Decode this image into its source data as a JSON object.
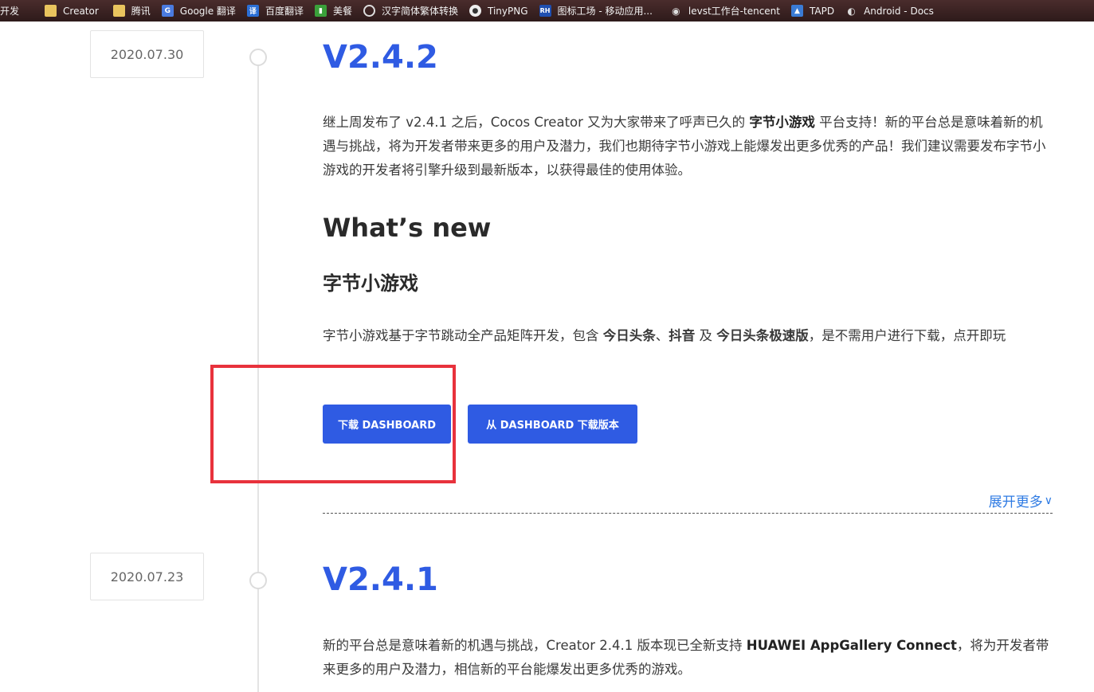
{
  "bookmarks": [
    {
      "label": "开发",
      "icon": "none"
    },
    {
      "label": "Creator",
      "icon": "folder-icon"
    },
    {
      "label": "腾讯",
      "icon": "folder-icon"
    },
    {
      "label": "Google 翻译",
      "icon": "google-translate-icon"
    },
    {
      "label": "百度翻译",
      "icon": "baidu-translate-icon"
    },
    {
      "label": "美餐",
      "icon": "meican-icon"
    },
    {
      "label": "汉字简体繁体转换",
      "icon": "globe-icon"
    },
    {
      "label": "TinyPNG",
      "icon": "panda-icon"
    },
    {
      "label": "图标工场 - 移动应用...",
      "icon": "rh-icon"
    },
    {
      "label": "levst工作台-tencent",
      "icon": "eye-icon"
    },
    {
      "label": "TAPD",
      "icon": "tapd-icon"
    },
    {
      "label": "Android - Docs",
      "icon": "android-icon"
    }
  ],
  "release1": {
    "date": "2020.07.30",
    "version": "V2.4.2",
    "intro": {
      "p1": "继上周发布了 v2.4.1 之后，Cocos Creator 又为大家带来了呼声已久的 ",
      "b1": "字节小游戏",
      "p2": " 平台支持！新的平台总是意味着新的机遇与挑战，将为开发者带来更多的用户及潜力，我们也期待字节小游戏上能爆发出更多优秀的产品！我们建议需要发布字节小游戏的开发者将引擎升级到最新版本，以获得最佳的使用体验。"
    },
    "whats_new": "What’s new",
    "section_title": "字节小游戏",
    "section_text": {
      "p1": "字节小游戏基于字节跳动全产品矩阵开发，包含 ",
      "b1": "今日头条",
      "p2": "、",
      "b2": "抖音",
      "p3": " 及 ",
      "b3": "今日头条极速版",
      "p4": "，是不需用户进行下载，点开即玩"
    },
    "buttons": {
      "download_dashboard": "下载 DASHBOARD",
      "download_from_dashboard": "从 DASHBOARD 下载版本"
    },
    "expand_more": "展开更多"
  },
  "release2": {
    "date": "2020.07.23",
    "version": "V2.4.1",
    "intro": {
      "p1": "新的平台总是意味着新的机遇与挑战，Creator 2.4.1 版本现已全新支持 ",
      "b1": "HUAWEI AppGallery Connect",
      "p2": "，将为开发者带来更多的用户及潜力，相信新的平台能爆发出更多优秀的游戏。"
    }
  }
}
